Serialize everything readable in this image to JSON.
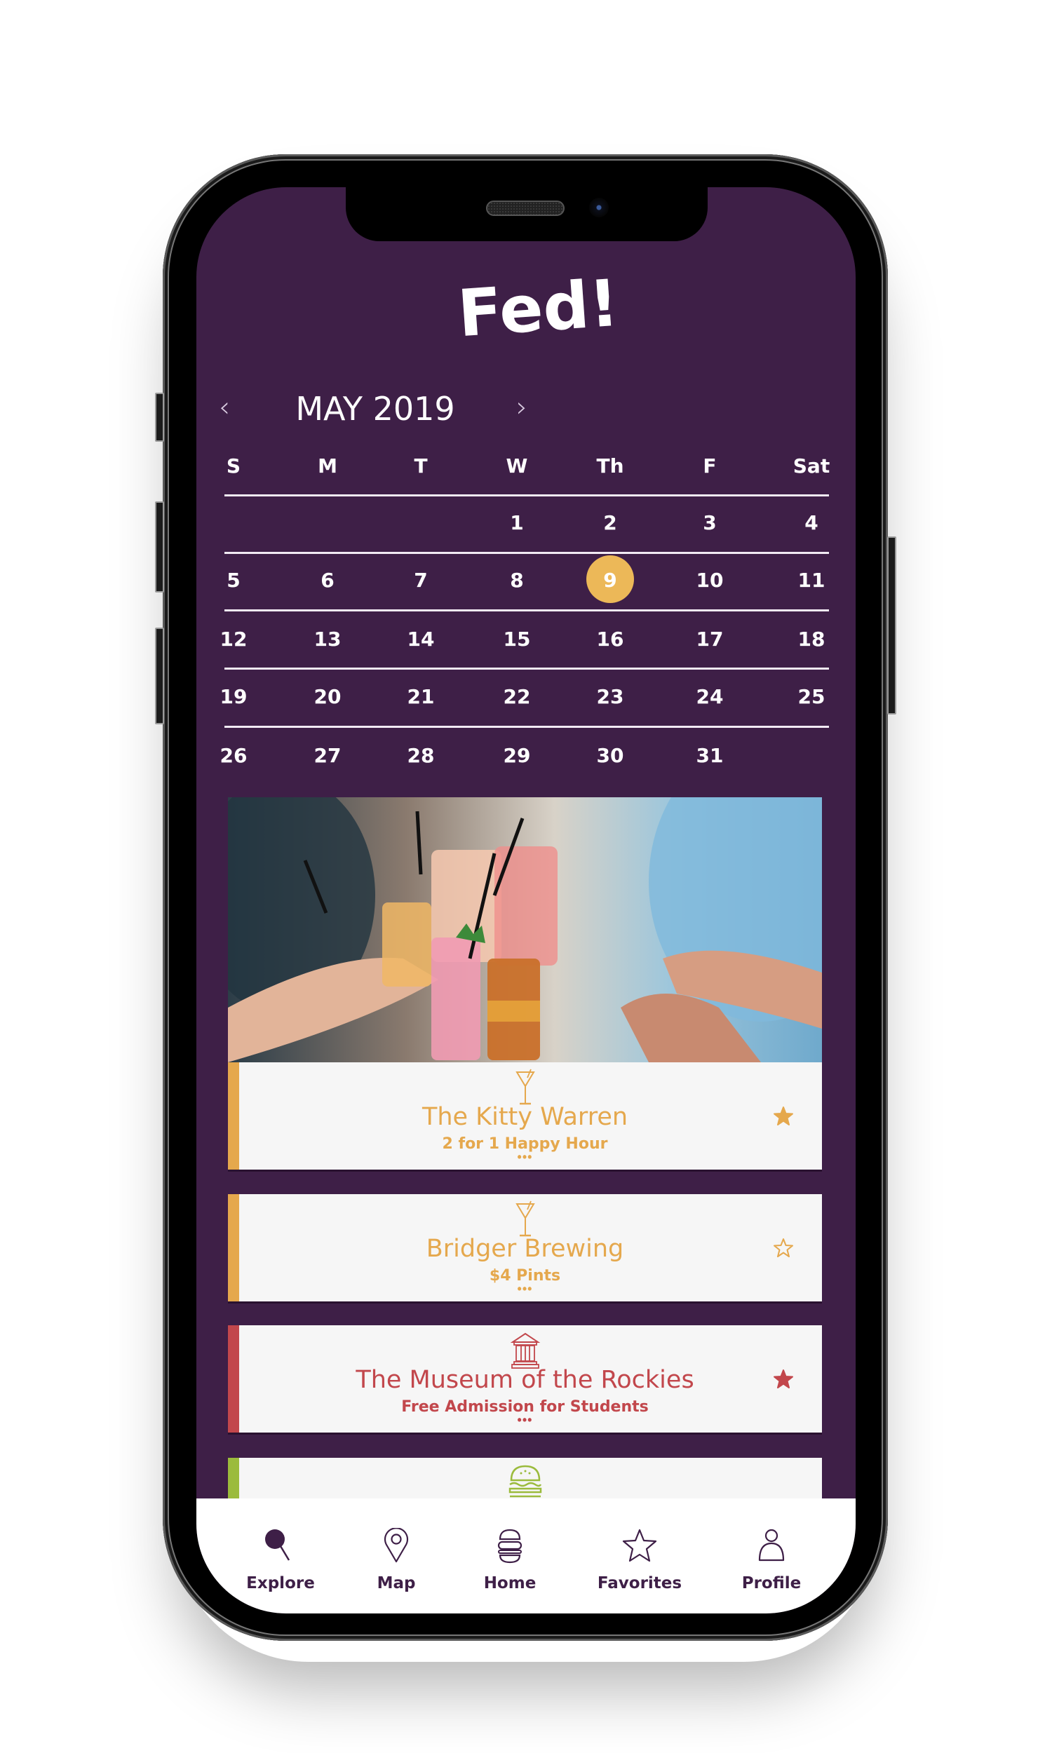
{
  "app": {
    "logo_text": "Fed!",
    "colors": {
      "background": "#3e1f47",
      "selected_day": "#ecb858",
      "drink": "#e5a84d",
      "museum": "#c2474c",
      "food": "#9bbb3c",
      "tab_text": "#3e1f47"
    }
  },
  "calendar": {
    "title": "MAY 2019",
    "prev_icon": "chevron-left-icon",
    "next_icon": "chevron-right-icon",
    "prev_label": "‹",
    "next_label": "›",
    "days_of_week": [
      "S",
      "M",
      "T",
      "W",
      "Th",
      "F",
      "Sat"
    ],
    "weeks": [
      [
        "",
        "",
        "",
        "1",
        "2",
        "3",
        "4"
      ],
      [
        "5",
        "6",
        "7",
        "8",
        "9",
        "10",
        "11"
      ],
      [
        "12",
        "13",
        "14",
        "15",
        "16",
        "17",
        "18"
      ],
      [
        "19",
        "20",
        "21",
        "22",
        "23",
        "24",
        "25"
      ],
      [
        "26",
        "27",
        "28",
        "29",
        "30",
        "31",
        ""
      ]
    ],
    "selected_day": "9"
  },
  "hero": {
    "description": "friends toasting cocktails and drinks",
    "icon": "photo"
  },
  "deals": [
    {
      "category": "drinks",
      "category_icon": "martini-glass-icon",
      "title": "The Kitty Warren",
      "subtitle": "2 for 1 Happy Hour",
      "more": "•••",
      "favorited": true,
      "color": "#e5a84d"
    },
    {
      "category": "drinks",
      "category_icon": "martini-glass-icon",
      "title": "Bridger Brewing",
      "subtitle": "$4 Pints",
      "more": "•••",
      "favorited": false,
      "color": "#e5a84d"
    },
    {
      "category": "museum",
      "category_icon": "museum-building-icon",
      "title": "The Museum of the Rockies",
      "subtitle": "Free Admission for Students",
      "more": "•••",
      "favorited": true,
      "color": "#c2474c"
    },
    {
      "category": "food",
      "category_icon": "burger-icon",
      "title": "",
      "subtitle": "",
      "more": "",
      "favorited": false,
      "color": "#9bbb3c"
    }
  ],
  "tabbar": {
    "active": "Explore",
    "tabs": [
      {
        "label": "Explore",
        "icon": "search-icon"
      },
      {
        "label": "Map",
        "icon": "map-pin-icon"
      },
      {
        "label": "Home",
        "icon": "burger-stack-icon"
      },
      {
        "label": "Favorites",
        "icon": "star-icon"
      },
      {
        "label": "Profile",
        "icon": "user-icon"
      }
    ]
  }
}
